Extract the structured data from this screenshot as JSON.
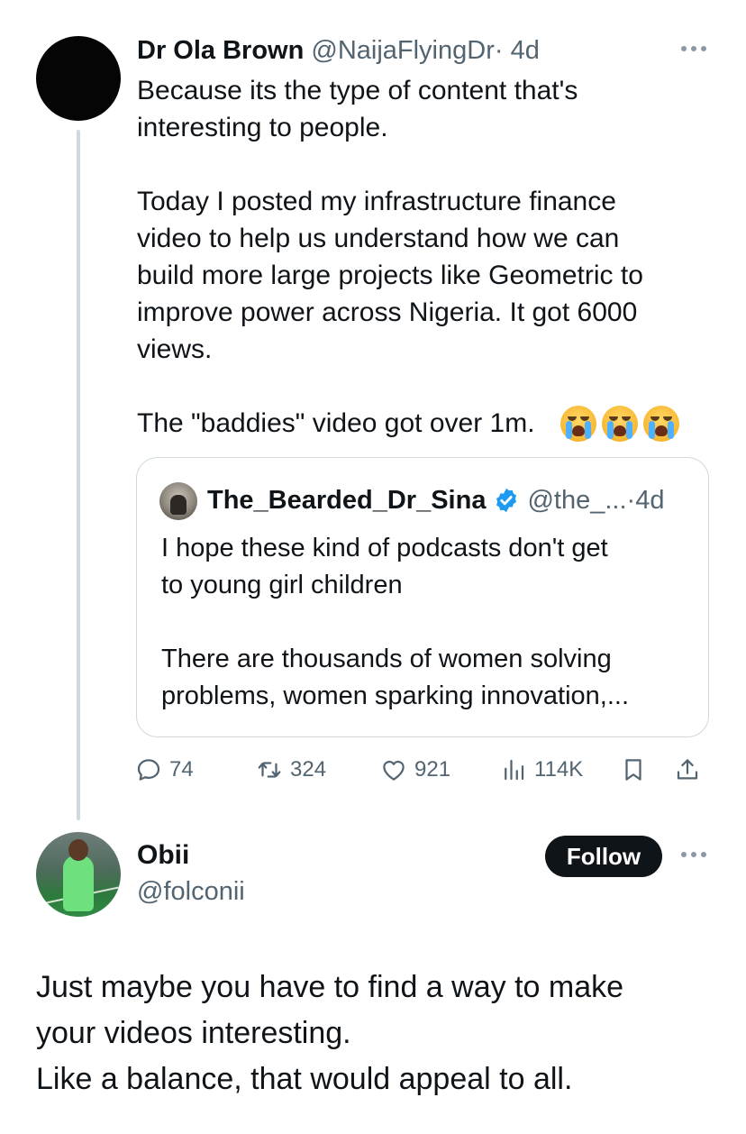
{
  "tweet": {
    "author_name": "Dr Ola Brown",
    "author_handle": "@NaijaFlyingDr",
    "separator": "·",
    "time": "4d",
    "body": "Because its the type of content that's\ninteresting to people.\n\nToday I posted my infrastructure finance\nvideo to help us understand how we can\nbuild more large projects like Geometric to\nimprove power across Nigeria. It got 6000\nviews.\n\nThe \"baddies\" video got over 1m.",
    "emojis": [
      "loudly-crying-face",
      "loudly-crying-face",
      "loudly-crying-face"
    ],
    "quote": {
      "author_name": "The_Bearded_Dr_Sina",
      "verified": true,
      "author_handle": "@the_...",
      "separator": "·",
      "time": "4d",
      "body": "I hope these kind of podcasts don't get\nto young girl children\n\nThere are thousands of women solving\nproblems, women sparking innovation,..."
    },
    "stats": {
      "replies": "74",
      "reposts": "324",
      "likes": "921",
      "views": "114K"
    }
  },
  "reply": {
    "author_name": "Obii",
    "author_handle": "@folconii",
    "follow_label": "Follow",
    "body": "Just maybe you have to find a way to make\nyour videos interesting.\nLike a balance, that would appeal to all."
  },
  "colors": {
    "text": "#0f1419",
    "secondary": "#536471",
    "verified": "#1d9bf0",
    "border": "#cfd9de"
  }
}
